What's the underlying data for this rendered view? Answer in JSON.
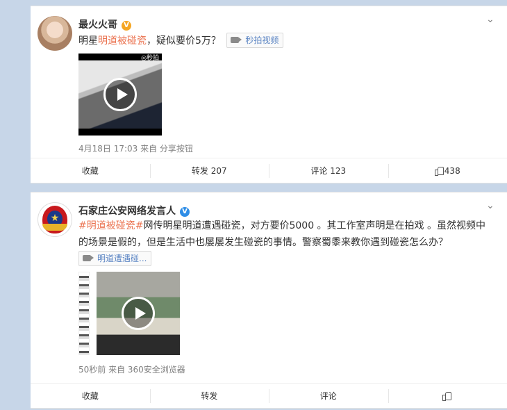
{
  "posts": [
    {
      "username": "最火火哥",
      "verified": "V",
      "text_prefix": "明星",
      "text_highlight": "明道被碰瓷",
      "text_suffix": "，疑似要价5万？",
      "video_tag": "秒拍视频",
      "video_watermark": "◎秒拍",
      "meta": "4月18日 17:03 来自 分享按钮",
      "actions": {
        "favorite": "收藏",
        "repost": "转发 207",
        "comment": "评论 123",
        "like": "438"
      }
    },
    {
      "username": "石家庄公安网络发言人",
      "verified": "V",
      "hashtag1": "#明道被碰瓷",
      "hashtag2": "#",
      "text_body": "网传明星明道遭遇碰瓷，对方要价5000 。其工作室声明是在拍戏 。虽然视频中的场景是假的，但是生活中也屡屡发生碰瓷的事情。警察蜀黍来教你遇到碰瓷怎么办？",
      "video_tag": "明道遭遇碰...",
      "meta": "50秒前 来自 360安全浏览器",
      "actions": {
        "favorite": "收藏",
        "repost": "转发",
        "comment": "评论",
        "like": ""
      }
    }
  ],
  "colors": {
    "highlight": "#eb7350",
    "link": "#5d86c4",
    "background": "#c7d6e8"
  }
}
